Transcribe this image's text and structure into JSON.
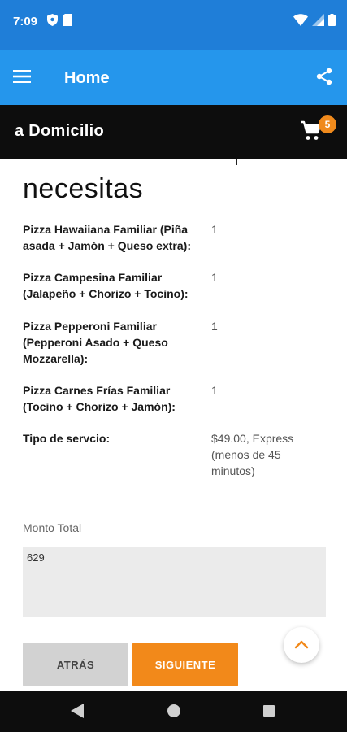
{
  "status_bar": {
    "time": "7:09",
    "icons": [
      "shield-icon",
      "sim-card-icon",
      "wifi-icon",
      "signal-icon",
      "battery-icon"
    ]
  },
  "app_bar": {
    "title": "Home",
    "menu_icon": "hamburger-menu-icon",
    "share_icon": "share-icon",
    "color": "#2596ec"
  },
  "sub_header": {
    "title": "a Domicilio",
    "cart_icon": "shopping-cart-icon",
    "cart_count": "5",
    "badge_color": "#f08a1c"
  },
  "main": {
    "heading": "necesitas",
    "order_items": [
      {
        "label": "Pizza Hawaiiana Familiar (Piña asada + Jamón + Queso extra):",
        "value": "1"
      },
      {
        "label": "Pizza Campesina Familiar (Jalapeño + Chorizo + Tocino):",
        "value": "1"
      },
      {
        "label": "Pizza Pepperoni Familiar (Pepperoni Asado + Queso Mozzarella):",
        "value": "1"
      },
      {
        "label": "Pizza Carnes Frías Familiar (Tocino + Chorizo + Jamón):",
        "value": "1"
      },
      {
        "label": "Tipo de servcio:",
        "value": "$49.00, Express (menos de 45 minutos)"
      }
    ],
    "total": {
      "label": "Monto Total",
      "value": "629"
    }
  },
  "buttons": {
    "back_label": "ATRÁS",
    "next_label": "SIGUIENTE",
    "next_color": "#f2891a",
    "scroll_top_icon": "chevron-up-icon"
  },
  "nav_bar": {
    "icons": [
      "back-triangle-icon",
      "home-circle-icon",
      "recents-square-icon"
    ]
  }
}
